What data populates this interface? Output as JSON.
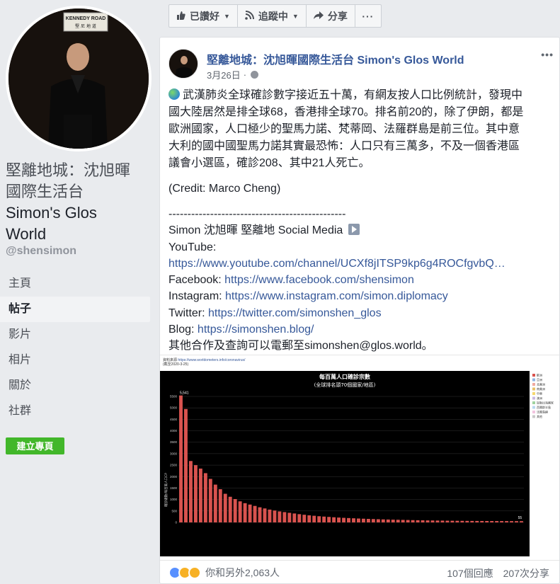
{
  "sidebar": {
    "page_name_zh_line1": "堅離地城：沈旭暉",
    "page_name_zh_line2": "國際生活台",
    "page_name_en_line1": "Simon's Glos",
    "page_name_en_line2": "World",
    "handle": "@shensimon",
    "avatar_sign": "KENNEDY ROAD",
    "avatar_sign_sub": "堅 尼 地 道",
    "nav": [
      "主頁",
      "帖子",
      "影片",
      "相片",
      "關於",
      "社群"
    ],
    "create_page": "建立專頁"
  },
  "actionbar": {
    "liked": "已讚好",
    "following": "追蹤中",
    "share": "分享",
    "more": "···"
  },
  "post": {
    "title": "堅離地城：沈旭暉國際生活台 Simon's Glos World",
    "date": "3月26日",
    "dot": "·",
    "more": "•••",
    "paragraph1_lines": [
      "武漢肺炎全球確診數字接近五十萬，有網友按人口比例統計，發現中",
      "國大陸居然是排全球68，香港排全球70。排名前20的，除了伊朗，都是",
      "歐洲國家，人口極少的聖馬力諾、梵蒂岡、法羅群島是前三位。其中意",
      "大利的國中國聖馬力諾其實最恐怖：人口只有三萬多，不及一個香港區",
      "議會小選區，確診208、其中21人死亡。"
    ],
    "credit": "(Credit: Marco Cheng)",
    "divider": "-----------------------------------------------",
    "social_title": "Simon 沈旭暉 堅離地 Social Media",
    "youtube_label": "YouTube:",
    "youtube_url": "https://www.youtube.com/channel/UCXf8jITSP9kp6g4ROCfgvbQ…",
    "facebook_label": "Facebook: ",
    "facebook_url": "https://www.facebook.com/shensimon",
    "instagram_label": "Instagram: ",
    "instagram_url": "https://www.instagram.com/simon.diplomacy",
    "twitter_label": "Twitter: ",
    "twitter_url": "https://twitter.com/simonshen_glos",
    "blog_label": "Blog: ",
    "blog_url": "https://simonshen.blog/",
    "contact": "其他合作及查詢可以電郵至simonshen@glos.world。"
  },
  "chart_image": {
    "source_label": "資料來源",
    "source_url": "https://www.worldometers.info/coronavirus/",
    "date_note": "(截至2020-3-25)",
    "title_line1": "每百萬人口確診宗數",
    "title_line2": "(全球排名頭70個國家/地區)",
    "top_value_label": "5,541",
    "last_value_label": "55",
    "ylabel": "確診總數/每百萬人口CP",
    "legend": [
      "歐洲",
      "亞洲",
      "北美洲",
      "南美洲",
      "中東",
      "澳洲",
      "加勒比海國家",
      "西爾群半島",
      "法屬島嶼",
      "其他"
    ],
    "legend_colors": [
      "#d9534f",
      "#8fb4e3",
      "#f0a9a0",
      "#e8c06a",
      "#f5d76e",
      "#c9b7e0",
      "#9fd3a0",
      "#b7d7f0",
      "#f2c4e0",
      "#c8c8c8"
    ]
  },
  "chart_data": {
    "type": "bar",
    "title": "每百萬人口確診宗數",
    "subtitle": "(全球排名頭70個國家/地區)",
    "ylabel": "確診總數/每百萬人口CP",
    "ylim": [
      0,
      5500
    ],
    "yticks": [
      0,
      500,
      1000,
      1500,
      2000,
      2500,
      3000,
      3500,
      4000,
      4500,
      5000,
      5500
    ],
    "values": [
      5541,
      4950,
      2680,
      2500,
      2350,
      2150,
      1900,
      1650,
      1450,
      1250,
      1120,
      1020,
      920,
      840,
      780,
      720,
      660,
      610,
      560,
      520,
      480,
      450,
      420,
      390,
      360,
      335,
      310,
      290,
      270,
      255,
      240,
      225,
      212,
      200,
      190,
      180,
      170,
      162,
      154,
      146,
      139,
      132,
      126,
      120,
      115,
      110,
      105,
      100,
      96,
      92,
      88,
      85,
      82,
      79,
      76,
      73,
      71,
      69,
      67,
      65,
      64,
      63,
      62,
      61,
      60,
      59,
      58,
      57,
      56,
      55
    ],
    "bar_color": "#d9534f",
    "grid": true
  },
  "footer": {
    "reaction_text": "你和另外2,063人",
    "comments": "107個回應",
    "shares": "207次分享"
  }
}
